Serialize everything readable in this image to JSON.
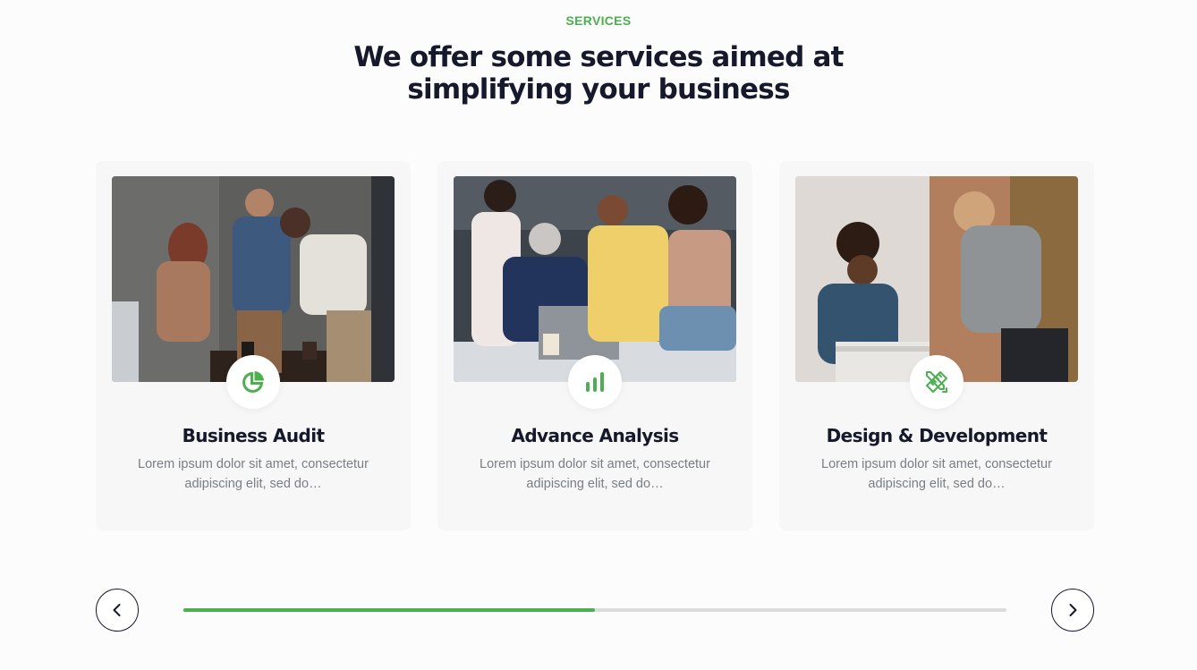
{
  "section": {
    "eyebrow": "SERVICES",
    "heading_line1": "We offer some services aimed at",
    "heading_line2": "simplifying your business"
  },
  "cards": [
    {
      "title": "Business Audit",
      "text_line1": "Lorem ipsum dolor sit amet, consectetur",
      "text_line2": "adipiscing elit, sed do…",
      "icon": "pie-chart-icon"
    },
    {
      "title": "Advance Analysis",
      "text_line1": "Lorem ipsum dolor sit amet, consectetur",
      "text_line2": "adipiscing elit, sed do…",
      "icon": "bar-chart-icon"
    },
    {
      "title": "Design & Development",
      "text_line1": "Lorem ipsum dolor sit amet, consectetur",
      "text_line2": "adipiscing elit, sed do…",
      "icon": "pencil-ruler-icon"
    }
  ],
  "slider": {
    "progress_percent": 50,
    "prev_icon": "chevron-left-icon",
    "next_icon": "chevron-right-icon"
  },
  "colors": {
    "accent": "#4caf50",
    "heading": "#15192b",
    "body_text": "#7a7d84",
    "card_bg": "#f6f7f6",
    "track": "#dcdcdc"
  }
}
